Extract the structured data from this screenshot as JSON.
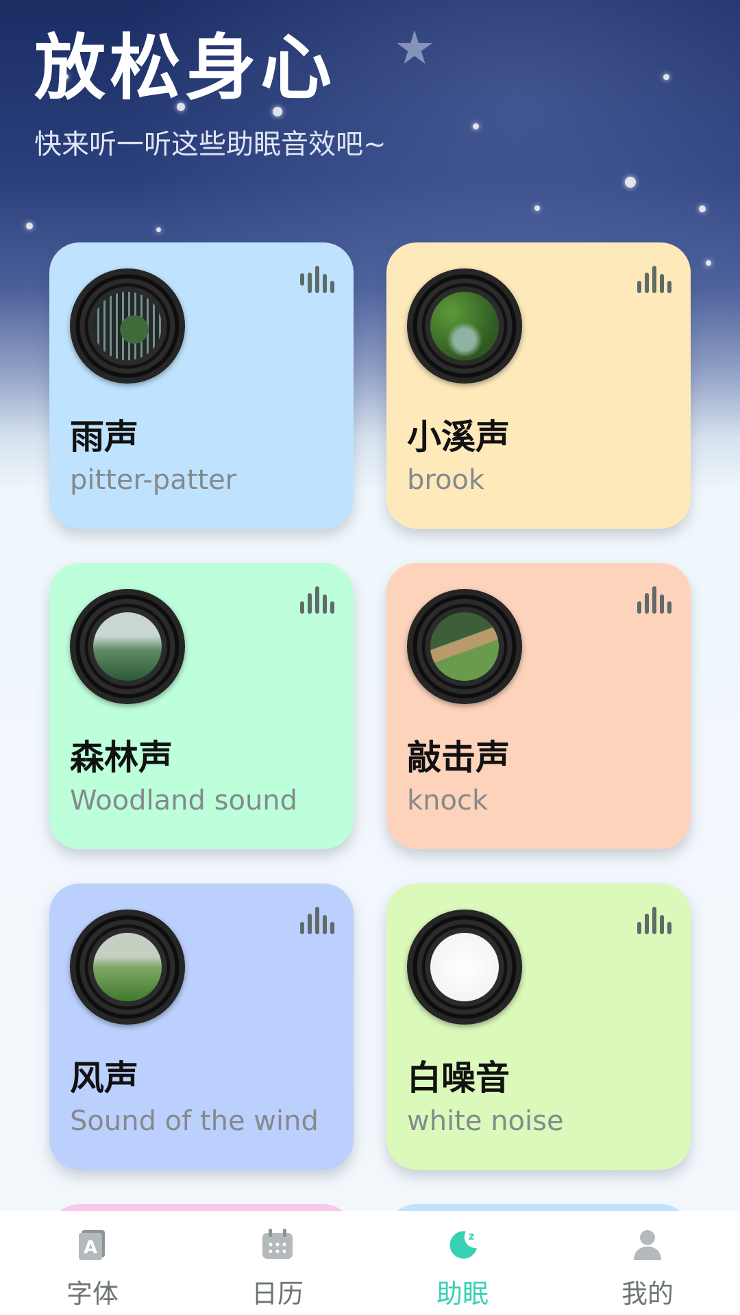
{
  "header": {
    "title": "放松身心",
    "subtitle": "快来听一听这些助眠音效吧~"
  },
  "sounds": [
    {
      "name": "雨声",
      "subtitle": "pitter-patter",
      "color": "#bfe3fe",
      "art": "rainy-window"
    },
    {
      "name": "小溪声",
      "subtitle": "brook",
      "color": "#fee9bb",
      "art": "forest-stream"
    },
    {
      "name": "森林声",
      "subtitle": "Woodland sound",
      "color": "#bdfedb",
      "art": "misty-forest"
    },
    {
      "name": "敲击声",
      "subtitle": "knock",
      "color": "#fed3bb",
      "art": "bamboo-fountain"
    },
    {
      "name": "风声",
      "subtitle": "Sound of the wind",
      "color": "#bcd0fe",
      "art": "windy-grassland"
    },
    {
      "name": "白噪音",
      "subtitle": "white noise",
      "color": "#dbf9ba",
      "art": "white-noise"
    }
  ],
  "peek_colors": [
    "#f8c9ee",
    "#bfe3fe"
  ],
  "tabbar": {
    "items": [
      {
        "label": "字体",
        "icon": "font-icon"
      },
      {
        "label": "日历",
        "icon": "calendar-icon"
      },
      {
        "label": "助眠",
        "icon": "sleep-moon-icon",
        "active": true
      },
      {
        "label": "我的",
        "icon": "profile-icon"
      }
    ],
    "active_color": "#37d2b4",
    "inactive_color": "#6e7475"
  }
}
